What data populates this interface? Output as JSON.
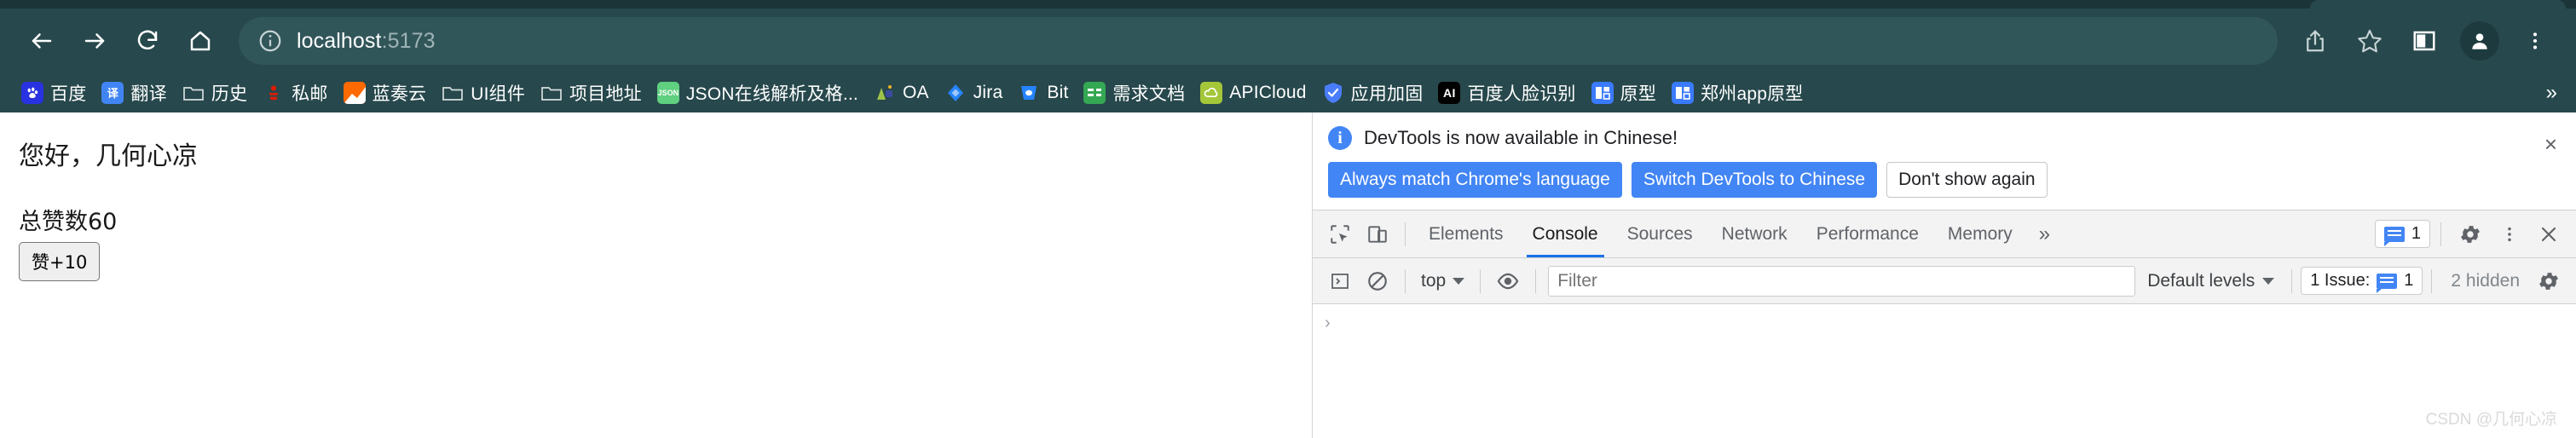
{
  "browser": {
    "nav": {
      "back_label": "Back",
      "forward_label": "Forward",
      "reload_label": "Reload",
      "home_label": "Home"
    },
    "omnibox": {
      "host": "localhost",
      "port": ":5173",
      "site_info_icon": "info-circle-icon"
    },
    "toolbar_right": {
      "share_label": "Share",
      "bookmark_label": "Bookmark this tab",
      "sidepanel_label": "Side panel",
      "profile_label": "Profile",
      "menu_label": "Customize and control Chrome"
    },
    "bookmarks": {
      "overflow_label": "»",
      "items": [
        {
          "label": "百度",
          "icon": "baidu-icon",
          "icon_class": "ico-baidu",
          "glyph": "熊"
        },
        {
          "label": "翻译",
          "icon": "translate-icon",
          "icon_class": "ico-fanyi",
          "glyph": "译"
        },
        {
          "label": "历史",
          "icon": "folder-icon",
          "icon_class": "ico-folder",
          "glyph": ""
        },
        {
          "label": "私邮",
          "icon": "netease-mail-icon",
          "icon_class": "ico-siyou",
          "glyph": ""
        },
        {
          "label": "蓝奏云",
          "icon": "lanzou-icon",
          "icon_class": "ico-lanzou",
          "glyph": ""
        },
        {
          "label": "UI组件",
          "icon": "folder-icon",
          "icon_class": "ico-folder",
          "glyph": ""
        },
        {
          "label": "项目地址",
          "icon": "folder-icon",
          "icon_class": "ico-folder",
          "glyph": ""
        },
        {
          "label": "JSON在线解析及格...",
          "icon": "json-icon",
          "icon_class": "ico-json",
          "glyph": "JSON"
        },
        {
          "label": "OA",
          "icon": "oa-icon",
          "icon_class": "ico-oa",
          "glyph": ""
        },
        {
          "label": "Jira",
          "icon": "jira-icon",
          "icon_class": "ico-jira",
          "glyph": ""
        },
        {
          "label": "Bit",
          "icon": "bitbucket-icon",
          "icon_class": "ico-bit",
          "glyph": ""
        },
        {
          "label": "需求文档",
          "icon": "sheets-icon",
          "icon_class": "ico-xqwd",
          "glyph": ""
        },
        {
          "label": "APICloud",
          "icon": "apicloud-icon",
          "icon_class": "ico-apicloud",
          "glyph": ""
        },
        {
          "label": "应用加固",
          "icon": "shield-icon",
          "icon_class": "ico-yyjg",
          "glyph": ""
        },
        {
          "label": "百度人脸识别",
          "icon": "ai-icon",
          "icon_class": "ico-ai",
          "glyph": "AI"
        },
        {
          "label": "原型",
          "icon": "prototype-icon",
          "icon_class": "ico-proto",
          "glyph": ""
        },
        {
          "label": "郑州app原型",
          "icon": "prototype-icon",
          "icon_class": "ico-proto",
          "glyph": ""
        }
      ]
    }
  },
  "page": {
    "greeting": "您好，几何心凉",
    "likes_text": "总赞数60",
    "like_button": "赞+10"
  },
  "devtools": {
    "banner": {
      "icon": "info-icon",
      "message": "DevTools is now available in Chinese!",
      "buttons": [
        {
          "label": "Always match Chrome's language",
          "style": "primary"
        },
        {
          "label": "Switch DevTools to Chinese",
          "style": "primary"
        },
        {
          "label": "Don't show again",
          "style": "plain"
        }
      ],
      "close_label": "×"
    },
    "tabbar": {
      "inspect_icon": "inspect-element-icon",
      "device_icon": "device-toolbar-icon",
      "tabs": [
        {
          "label": "Elements",
          "active": false
        },
        {
          "label": "Console",
          "active": true
        },
        {
          "label": "Sources",
          "active": false
        },
        {
          "label": "Network",
          "active": false
        },
        {
          "label": "Performance",
          "active": false
        },
        {
          "label": "Memory",
          "active": false
        }
      ],
      "more_tabs_label": "»",
      "issue_badge_count": "1",
      "settings_icon": "gear-icon",
      "menu_icon": "kebab-menu-icon",
      "close_icon": "close-icon"
    },
    "console_toolbar": {
      "sidebar_icon": "console-sidebar-icon",
      "clear_icon": "clear-console-icon",
      "context_value": "top",
      "eye_icon": "live-expression-icon",
      "filter_placeholder": "Filter",
      "filter_value": "",
      "levels_value": "Default levels",
      "issues_label": "1 Issue:",
      "issues_count": "1",
      "hidden_label": "2 hidden",
      "settings_icon": "gear-icon"
    },
    "console": {
      "prompt_symbol": "›",
      "prompt_value": ""
    }
  },
  "watermark": "CSDN @几何心凉",
  "colors": {
    "chrome_bg": "#27484c",
    "chrome_bg_dark": "#1b3437",
    "omnibox_bg": "#31565a",
    "accent_blue": "#4285f4",
    "tab_underline": "#1a73e8"
  }
}
